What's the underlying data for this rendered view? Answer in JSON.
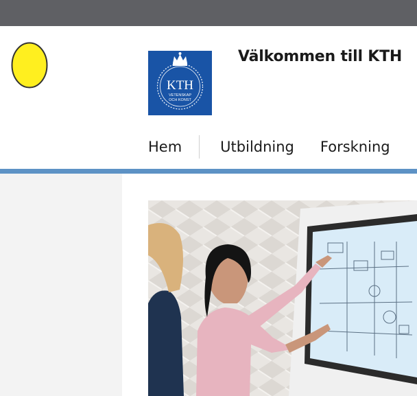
{
  "header": {
    "welcome_text": "Välkommen till KTH",
    "logo": {
      "main_text": "KTH",
      "line1": "VETENSKAP",
      "line2": "OCH KONST",
      "background": "#1954a6"
    }
  },
  "nav": {
    "items": [
      {
        "label": "Hem"
      },
      {
        "label": "Utbildning"
      },
      {
        "label": "Forskning"
      }
    ]
  },
  "colors": {
    "browser_bar": "#5f6064",
    "accent_rule": "#5d92c5",
    "sidebar": "#f3f3f3",
    "egg": "#ffef1f"
  },
  "icons": {
    "egg": "yellow-egg-icon",
    "crown": "crown-icon"
  }
}
